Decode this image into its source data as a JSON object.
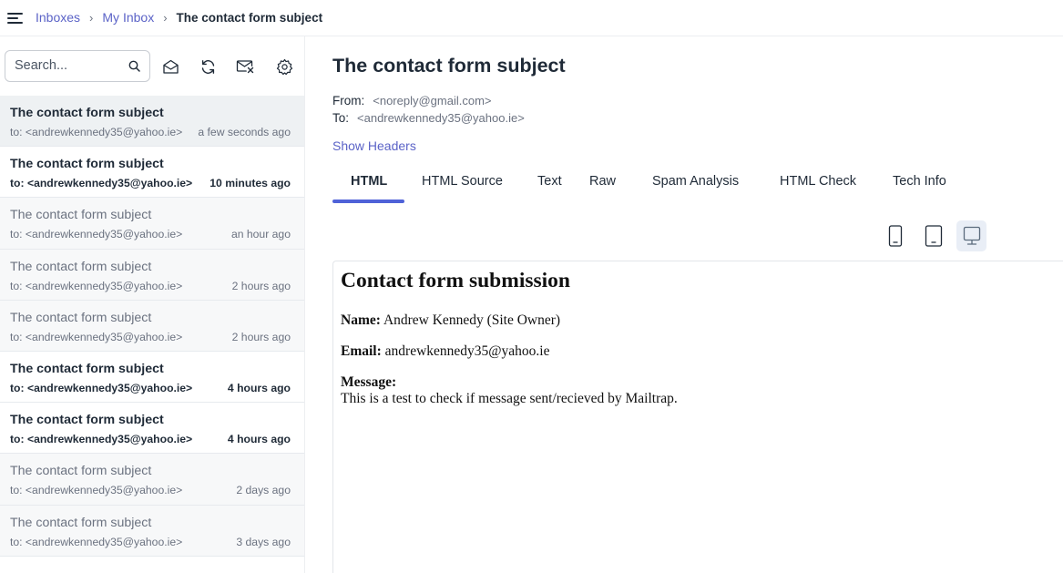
{
  "breadcrumb": {
    "items": [
      "Inboxes",
      "My Inbox"
    ],
    "separator": "›",
    "current": "The contact form subject"
  },
  "search": {
    "placeholder": "Search..."
  },
  "toolbar_icons": [
    "search-icon",
    "envelope-open-icon",
    "refresh-icon",
    "mark-read-icon",
    "gear-icon"
  ],
  "messages": [
    {
      "subject": "The contact form subject",
      "to": "to: <andrewkennedy35@yahoo.ie>",
      "time": "a few seconds ago",
      "state": "active"
    },
    {
      "subject": "The contact form subject",
      "to": "to: <andrewkennedy35@yahoo.ie>",
      "time": "10 minutes ago",
      "state": "unread"
    },
    {
      "subject": "The contact form subject",
      "to": "to: <andrewkennedy35@yahoo.ie>",
      "time": "an hour ago",
      "state": "read"
    },
    {
      "subject": "The contact form subject",
      "to": "to: <andrewkennedy35@yahoo.ie>",
      "time": "2 hours ago",
      "state": "read"
    },
    {
      "subject": "The contact form subject",
      "to": "to: <andrewkennedy35@yahoo.ie>",
      "time": "2 hours ago",
      "state": "read"
    },
    {
      "subject": "The contact form subject",
      "to": "to: <andrewkennedy35@yahoo.ie>",
      "time": "4 hours ago",
      "state": "unread"
    },
    {
      "subject": "The contact form subject",
      "to": "to: <andrewkennedy35@yahoo.ie>",
      "time": "4 hours ago",
      "state": "unread"
    },
    {
      "subject": "The contact form subject",
      "to": "to: <andrewkennedy35@yahoo.ie>",
      "time": "2 days ago",
      "state": "read"
    },
    {
      "subject": "The contact form subject",
      "to": "to: <andrewkennedy35@yahoo.ie>",
      "time": "3 days ago",
      "state": "read"
    }
  ],
  "email": {
    "subject": "The contact form subject",
    "from_label": "From:",
    "from_value": "<noreply@gmail.com>",
    "to_label": "To:",
    "to_value": "<andrewkennedy35@yahoo.ie>",
    "show_headers": "Show Headers"
  },
  "tabs": [
    "HTML",
    "HTML Source",
    "Text",
    "Raw",
    "Spam Analysis",
    "HTML Check",
    "Tech Info"
  ],
  "active_tab": "HTML",
  "device_icons": [
    "mobile-icon",
    "tablet-icon",
    "desktop-icon"
  ],
  "active_device": "desktop-icon",
  "preview": {
    "heading": "Contact form submission",
    "name_label": "Name:",
    "name_value": "Andrew Kennedy (Site Owner)",
    "email_label": "Email:",
    "email_value": "andrewkennedy35@yahoo.ie",
    "message_label": "Message:",
    "message_value": "This is a test to check if message sent/recieved by Mailtrap."
  },
  "colors": {
    "accent": "#4f62d8",
    "link": "#5b63c7",
    "text": "#1f2a37",
    "muted": "#6b7280"
  }
}
